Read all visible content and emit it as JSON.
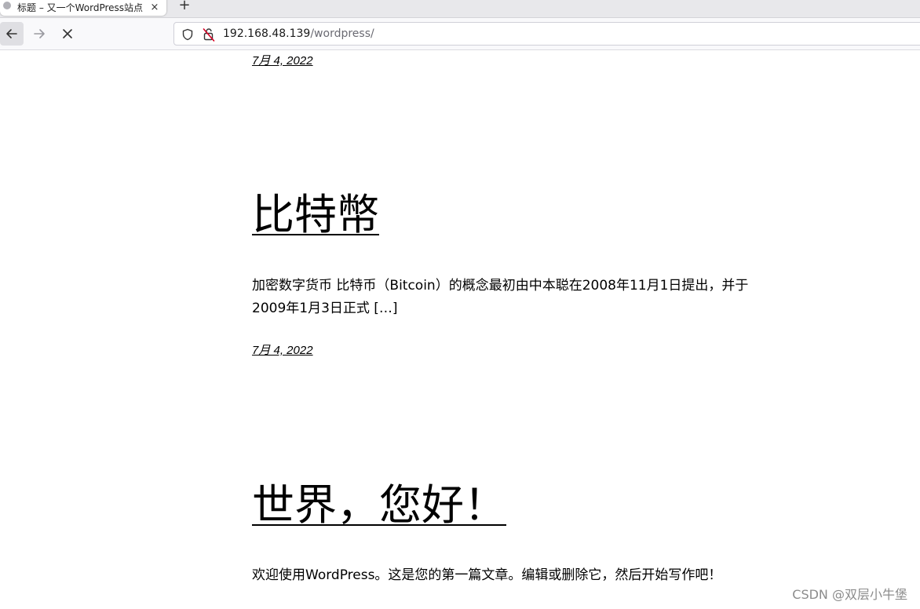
{
  "browser": {
    "tab_title": "标题 – 又一个WordPress站点",
    "tab_close": "×",
    "new_tab": "+",
    "url_host": "192.168.48.139",
    "url_path": "/wordpress/"
  },
  "posts": [
    {
      "date": "7月 4, 2022"
    },
    {
      "title": "比特幣",
      "excerpt": "加密数字货币 比特币（Bitcoin）的概念最初由中本聪在2008年11月1日提出，并于2009年1月3日正式 […]",
      "date": "7月 4, 2022"
    },
    {
      "title": "世界，您好！",
      "excerpt": "欢迎使用WordPress。这是您的第一篇文章。编辑或删除它，然后开始写作吧！"
    }
  ],
  "watermark": "CSDN @双层小牛堡"
}
